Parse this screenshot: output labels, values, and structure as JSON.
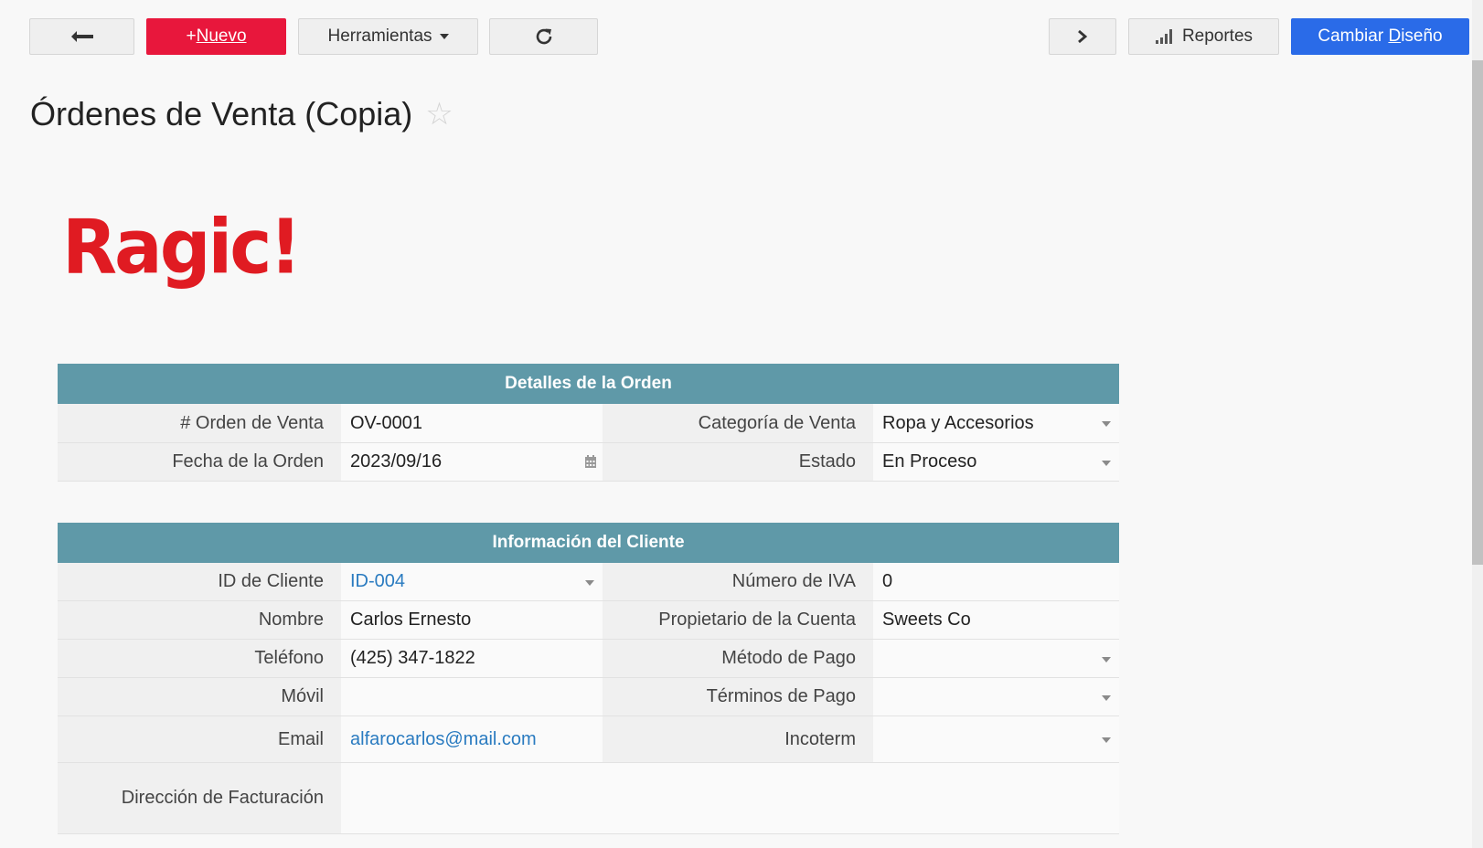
{
  "toolbar": {
    "new_plus": "+",
    "new_label": "Nuevo",
    "tools_label": "Herramientas",
    "reports_label": "Reportes",
    "design_prefix": "Cambiar ",
    "design_underlined": "D",
    "design_suffix": "iseño"
  },
  "page": {
    "title": "Órdenes de Venta (Copia)",
    "logo_text": "Ragic!"
  },
  "colors": {
    "primary_red": "#e8173c",
    "primary_blue": "#2a6be8",
    "section_header": "#5f99a8",
    "link": "#2a7bc0"
  },
  "sections": {
    "order": {
      "title": "Detalles de la Orden",
      "order_no_label": "# Orden de Venta",
      "order_no": "OV-0001",
      "category_label": "Categoría de Venta",
      "category": "Ropa y Accesorios",
      "date_label": "Fecha de la Orden",
      "date": "2023/09/16",
      "status_label": "Estado",
      "status": "En Proceso"
    },
    "customer": {
      "title": "Información del Cliente",
      "id_label": "ID de Cliente",
      "id": "ID-004",
      "vat_label": "Número de IVA",
      "vat": "0",
      "name_label": "Nombre",
      "name": "Carlos Ernesto",
      "owner_label": "Propietario de la Cuenta",
      "owner": "Sweets Co",
      "phone_label": "Teléfono",
      "phone": "(425) 347-1822",
      "payment_method_label": "Método de Pago",
      "payment_method": "",
      "mobile_label": "Móvil",
      "mobile": "",
      "payment_terms_label": "Términos de Pago",
      "payment_terms": "",
      "email_label": "Email",
      "email": "alfarocarlos@mail.com",
      "incoterm_label": "Incoterm",
      "incoterm": "",
      "billing_label": "Dirección de Facturación",
      "billing": ""
    }
  }
}
